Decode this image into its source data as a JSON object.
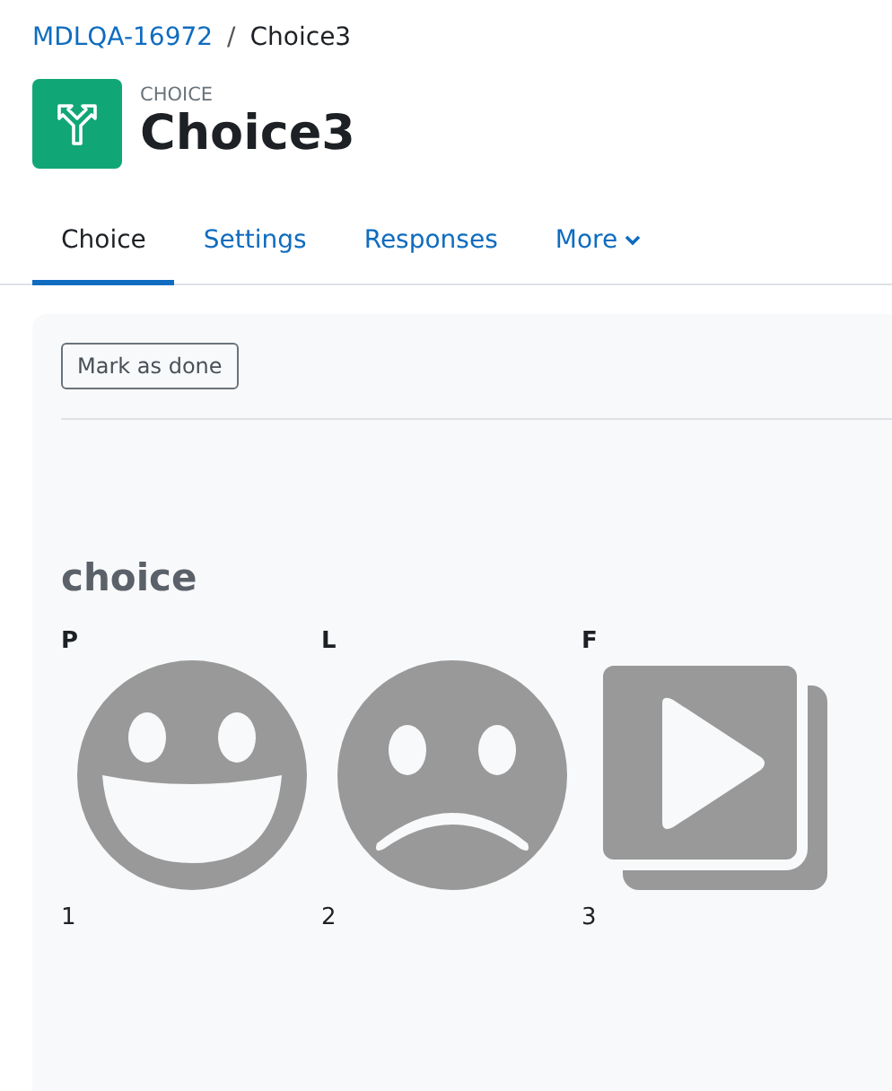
{
  "breadcrumb": {
    "items": [
      {
        "text": "MDLQA-16972",
        "kind": "link"
      },
      {
        "text": "Choice3",
        "kind": "current"
      }
    ],
    "separator": "/"
  },
  "header": {
    "type_label": "CHOICE",
    "title": "Choice3"
  },
  "tabs": [
    {
      "label": "Choice",
      "selected": true,
      "dropdown": false
    },
    {
      "label": "Settings",
      "selected": false,
      "dropdown": false
    },
    {
      "label": "Responses",
      "selected": false,
      "dropdown": false
    },
    {
      "label": "More",
      "selected": false,
      "dropdown": true
    }
  ],
  "content": {
    "button": "Mark as done",
    "heading": "choice",
    "options": [
      {
        "label": "P",
        "kind": "happy",
        "value": "1"
      },
      {
        "label": "L",
        "kind": "sad",
        "value": "2"
      },
      {
        "label": "F",
        "kind": "video",
        "value": "3"
      }
    ]
  }
}
